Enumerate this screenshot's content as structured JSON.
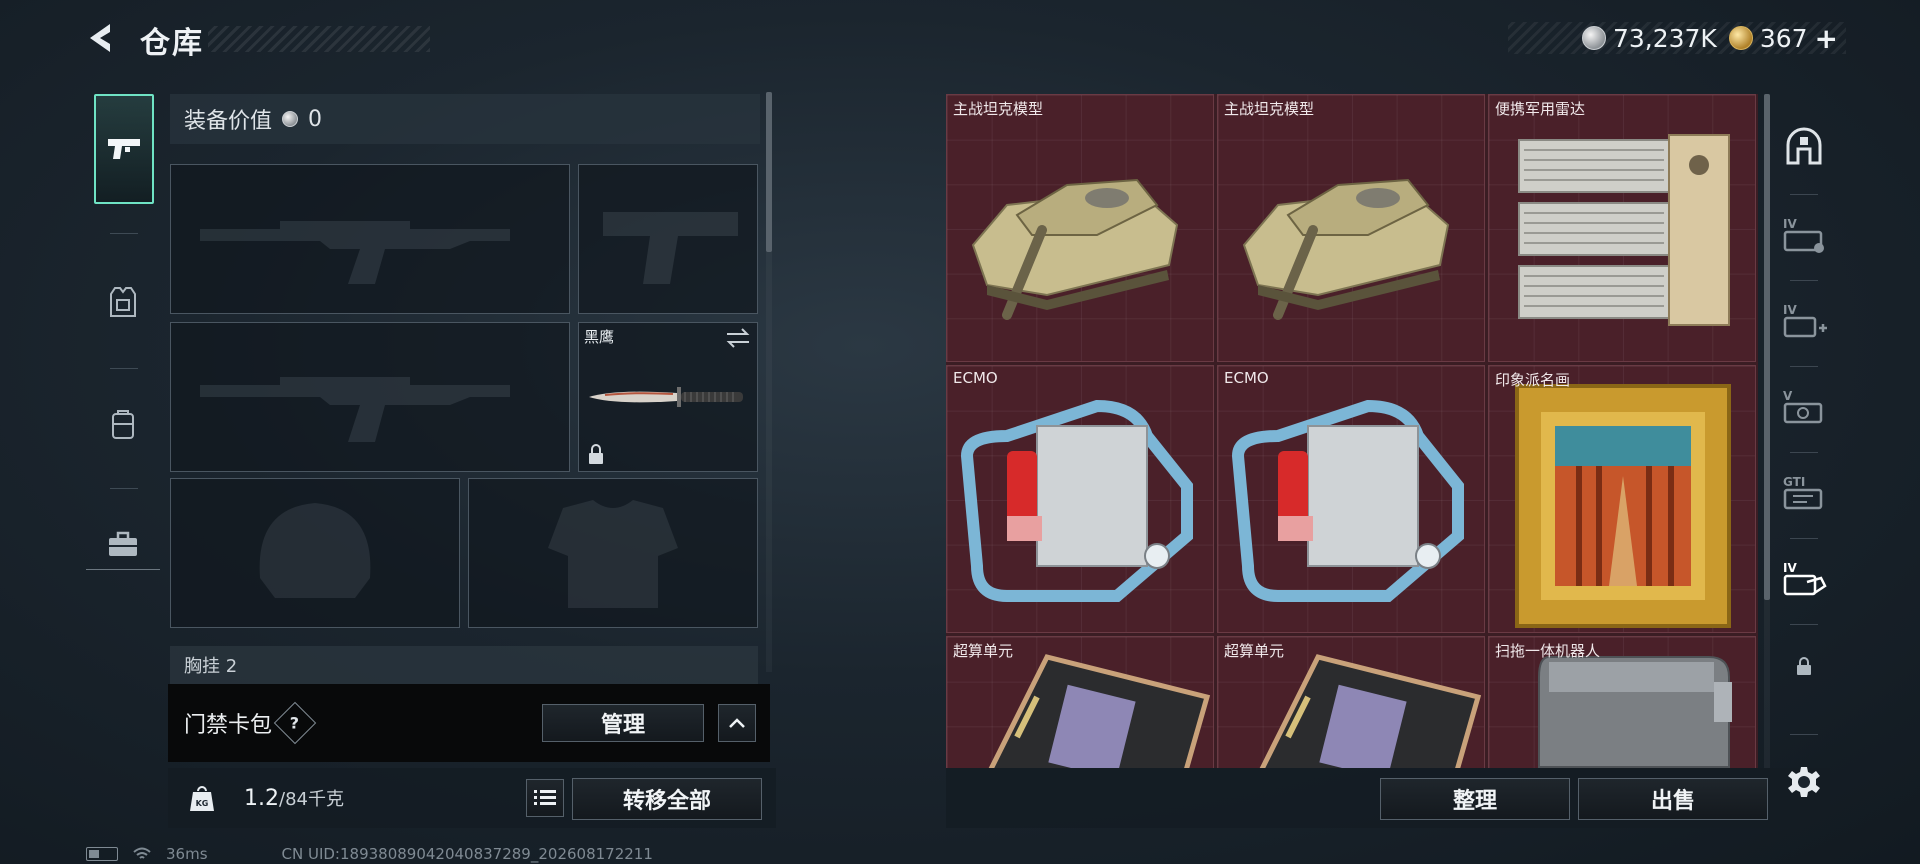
{
  "header": {
    "title": "仓库"
  },
  "currency": {
    "silver": "73,237K",
    "gold": "367",
    "gold_plus": "+"
  },
  "left_nav": [
    {
      "name": "weapons",
      "icon": "pistol-icon",
      "active": true
    },
    {
      "name": "armor",
      "icon": "chest-rig-icon",
      "active": false
    },
    {
      "name": "backpack",
      "icon": "backpack-icon",
      "active": false
    },
    {
      "name": "case",
      "icon": "briefcase-icon",
      "active": false
    }
  ],
  "equipment": {
    "value_label": "装备价值",
    "value": "0",
    "melee_label": "黑鹰",
    "chest_rig_label": "胸挂",
    "chest_rig_count": "2"
  },
  "keycard": {
    "label": "门禁卡包",
    "help": "?",
    "manage_label": "管理"
  },
  "capacity": {
    "current": "1.2",
    "max": "/84千克",
    "transfer_all_label": "转移全部"
  },
  "grid_items": [
    {
      "label": "主战坦克模型",
      "icon": "tank-icon"
    },
    {
      "label": "主战坦克模型",
      "icon": "tank-icon"
    },
    {
      "label": "便携军用雷达",
      "icon": "radar-icon"
    },
    {
      "label": "ECMO",
      "icon": "ecmo-icon"
    },
    {
      "label": "ECMO",
      "icon": "ecmo-icon"
    },
    {
      "label": "印象派名画",
      "icon": "painting-icon"
    },
    {
      "label": "超算单元",
      "icon": "supercomputer-icon"
    },
    {
      "label": "超算单元",
      "icon": "supercomputer-icon"
    },
    {
      "label": "扫拖一体机器人",
      "icon": "robot-vacuum-icon"
    }
  ],
  "actions": {
    "organize_label": "整理",
    "sell_label": "出售"
  },
  "right_nav": [
    {
      "name": "storage-main",
      "icon": "storage-icon",
      "badge": ""
    },
    {
      "name": "storage-iv",
      "icon": "storage-iv-icon",
      "badge": "IV"
    },
    {
      "name": "storage-iv-plus",
      "icon": "storage-iv-plus-icon",
      "badge": "IV"
    },
    {
      "name": "storage-v",
      "icon": "storage-v-icon",
      "badge": "V"
    },
    {
      "name": "storage-gti",
      "icon": "storage-gti-icon",
      "badge": "GTI"
    },
    {
      "name": "storage-iv-hand",
      "icon": "storage-iv-hand-icon",
      "badge": "IV"
    },
    {
      "name": "locked",
      "icon": "lock-icon",
      "badge": ""
    },
    {
      "name": "settings",
      "icon": "gear-icon",
      "badge": ""
    }
  ],
  "status": {
    "ping": "36ms",
    "uid": "CN UID:18938089042040837289_202608172211"
  }
}
